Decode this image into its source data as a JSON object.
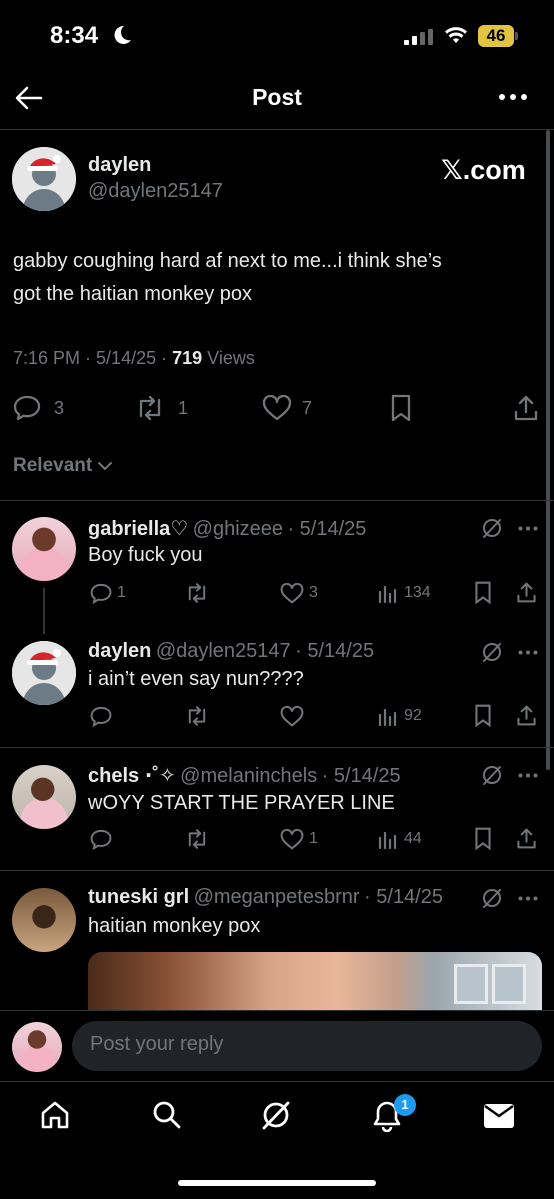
{
  "status_bar": {
    "time": "8:34",
    "battery": "46"
  },
  "nav": {
    "title": "Post"
  },
  "post": {
    "display_name": "daylen",
    "handle": "@daylen25147",
    "source_label": "𝕏.com",
    "text_line1": "gabby coughing hard af next to me...i think she’s",
    "text_line2": "got the haitian monkey pox",
    "time": "7:16 PM",
    "date": "5/14/25",
    "views_count": "719",
    "views_label": "Views",
    "replies": "3",
    "reposts": "1",
    "likes": "7"
  },
  "sort": {
    "label": "Relevant"
  },
  "replies": [
    {
      "name": "gabriella♡",
      "handle": "@ghizeee",
      "date": "· 5/14/25",
      "text": "Boy fuck you",
      "replies": "1",
      "reposts": "",
      "likes": "3",
      "views": "134"
    },
    {
      "name": "daylen",
      "handle": "@daylen25147",
      "date": "· 5/14/25",
      "text": "i ain’t even say nun????",
      "replies": "",
      "reposts": "",
      "likes": "",
      "views": "92"
    },
    {
      "name": "chels ⋅˚✧",
      "handle": "@melaninchels",
      "date": "· 5/14/25",
      "text": "wOYY START THE PRAYER LINE",
      "replies": "",
      "reposts": "",
      "likes": "1",
      "views": "44"
    },
    {
      "name": "tuneski grl",
      "handle": "@meganpetesbrnr",
      "date": "· 5/14/25",
      "text": "haitian monkey pox"
    }
  ],
  "composer": {
    "placeholder": "Post your reply"
  },
  "tab_bar": {
    "notification_count": "1"
  },
  "colors": {
    "background": "#000000",
    "text": "#e7e9ea",
    "muted": "#71767b",
    "accent": "#1d9bf0",
    "battery": "#e1c542"
  }
}
